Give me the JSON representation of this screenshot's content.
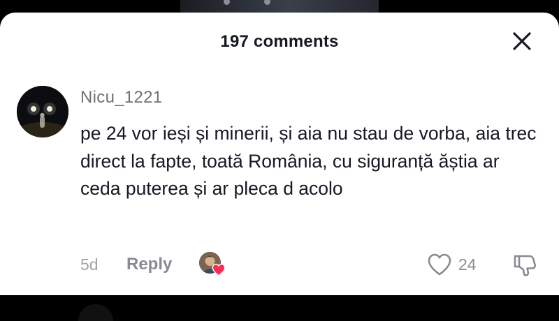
{
  "header": {
    "title": "197 comments"
  },
  "comment": {
    "username": "Nicu_1221",
    "text": "pe 24 vor ieși și minerii, și aia nu stau de vorba, aia trec direct la fapte, toată România, cu siguranță ăștia ar ceda puterea și ar pleca d acolo",
    "time": "5d",
    "reply_label": "Reply",
    "like_count": "24"
  },
  "icons": {
    "close": "close-icon",
    "like": "heart-outline-icon",
    "dislike": "thumbs-down-icon",
    "creator_liked": "heart-filled-icon"
  },
  "colors": {
    "primary_text": "#161823",
    "secondary_text": "#8a8b91",
    "heart_accent": "#fe2c55"
  }
}
